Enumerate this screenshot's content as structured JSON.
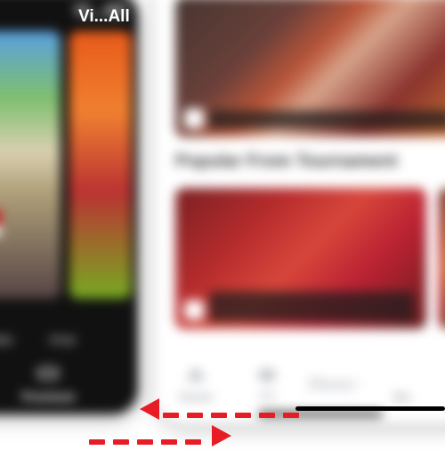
{
  "colors": {
    "accent_red": "#e81c24",
    "muted": "#a8abb2"
  },
  "left_app": {
    "header_link": "Vi...All",
    "captions": [
      "Impossible",
      "#Gal"
    ],
    "nav": [
      {
        "key": "sports",
        "label": "orts"
      },
      {
        "key": "premium",
        "label": "Premium"
      }
    ]
  },
  "right_app": {
    "section_title": "Popular From Tournament",
    "nav": [
      {
        "key": "home",
        "label": "Home"
      },
      {
        "key": "tv",
        "label": "TV"
      },
      {
        "key": "disney",
        "label": "Disney+"
      },
      {
        "key": "more",
        "label": "Mo"
      }
    ]
  },
  "gesture": {
    "hint": "swipe-horizontal",
    "arrows": [
      "left",
      "right"
    ]
  }
}
